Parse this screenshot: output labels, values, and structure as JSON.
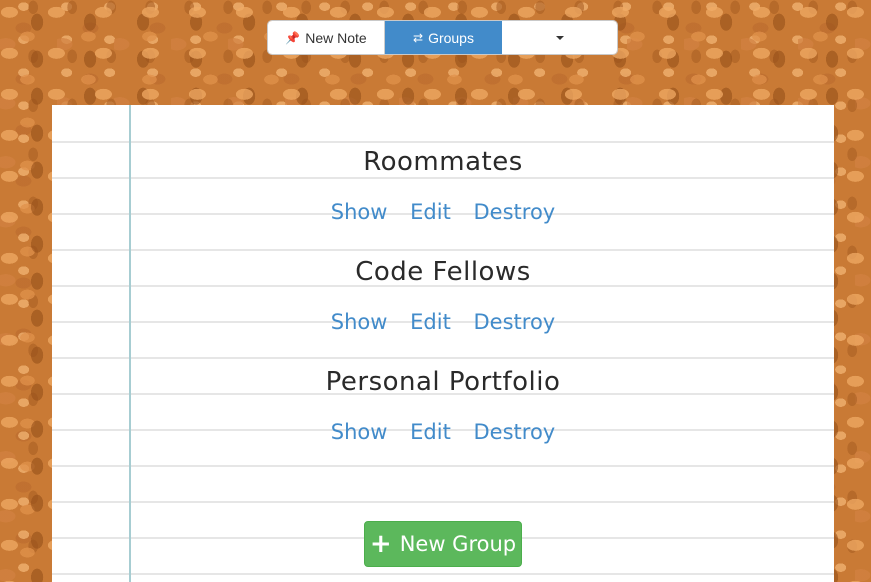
{
  "toolbar": {
    "new_note_icon": "pushpin-icon",
    "new_note_label": "New Note",
    "groups_icon": "swap-arrows-icon",
    "groups_label": "Groups",
    "dropdown_icon": "caret-down-icon",
    "active_color": "#428bca"
  },
  "groups": [
    {
      "name": "Roommates",
      "show": "Show",
      "edit": "Edit",
      "destroy": "Destroy"
    },
    {
      "name": "Code Fellows",
      "show": "Show",
      "edit": "Edit",
      "destroy": "Destroy"
    },
    {
      "name": "Personal Portfolio",
      "show": "Show",
      "edit": "Edit",
      "destroy": "Destroy"
    }
  ],
  "new_group": {
    "icon": "plus-icon",
    "label": "New Group",
    "color": "#5cb85c"
  },
  "colors": {
    "link": "#428bca",
    "margin_line": "#a7cdd2",
    "corkboard": "#c97a35"
  }
}
